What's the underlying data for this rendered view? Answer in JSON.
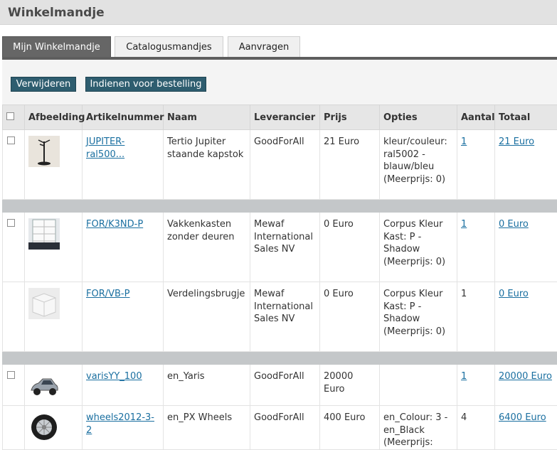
{
  "header": {
    "title": "Winkelmandje"
  },
  "tabs": [
    "Mijn Winkelmandje",
    "Catalogusmandjes",
    "Aanvragen"
  ],
  "actions": {
    "delete": "Verwijderen",
    "submit": "Indienen voor bestelling"
  },
  "columns": [
    "Afbeelding",
    "Artikelnummer",
    "Naam",
    "Leverancier",
    "Prijs",
    "Opties",
    "Aantal",
    "Totaal"
  ],
  "rows": [
    {
      "article": "JUPITER-ral500...",
      "name": "Tertio Jupiter staande kapstok",
      "supplier": "GoodForAll",
      "price": "21 Euro",
      "options": "kleur/couleur: ral5002 - blauw/bleu (Meerprijs: 0)",
      "qty": "1",
      "total": "21 Euro",
      "image": "coat-stand-image"
    },
    {
      "article": "FOR/K3ND-P",
      "name": "Vakkenkasten zonder deuren",
      "supplier": "Mewaf International Sales NV",
      "price": "0 Euro",
      "options": "Corpus Kleur Kast: P - Shadow (Meerprijs: 0)",
      "qty": "1",
      "total": "0 Euro",
      "image": "cabinet-image"
    },
    {
      "article": "FOR/VB-P",
      "name": "Verdelingsbrugje",
      "supplier": "Mewaf International Sales NV",
      "price": "0 Euro",
      "options": "Corpus Kleur Kast: P - Shadow (Meerprijs: 0)",
      "qty": "1",
      "total": "0 Euro",
      "image": "box-image"
    },
    {
      "article": "varisYY_100",
      "name": "en_Yaris",
      "supplier": "GoodForAll",
      "price": "20000 Euro",
      "options": "",
      "qty": "1",
      "total": "20000 Euro",
      "image": "car-image"
    },
    {
      "article": "wheels2012-3-2",
      "name": "en_PX Wheels",
      "supplier": "GoodForAll",
      "price": "400 Euro",
      "options": "en_Colour: 3 - en_Black (Meerprijs:",
      "qty": "4",
      "total": "6400 Euro",
      "image": "wheel-image"
    }
  ]
}
